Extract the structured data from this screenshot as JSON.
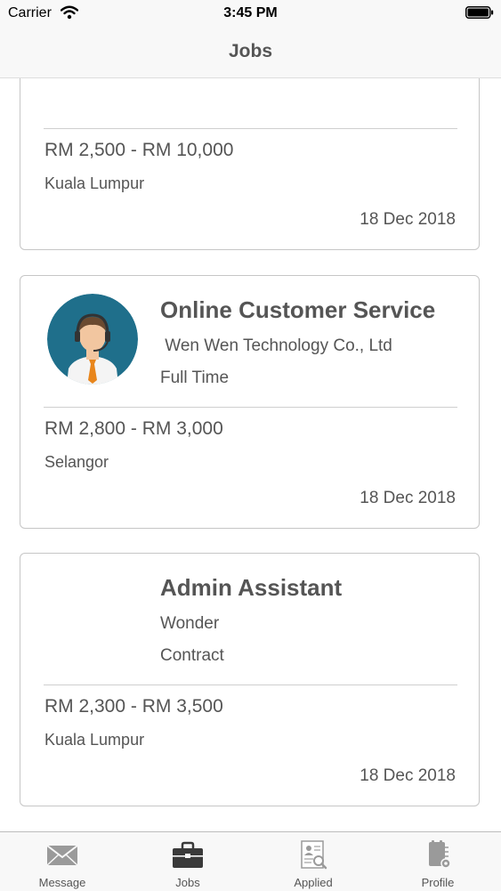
{
  "status_bar": {
    "carrier": "Carrier",
    "time": "3:45 PM"
  },
  "nav": {
    "title": "Jobs"
  },
  "jobs": [
    {
      "title": "",
      "company": "",
      "type": "",
      "salary": "RM 2,500 - RM 10,000",
      "location": "Kuala Lumpur",
      "date": "18 Dec 2018"
    },
    {
      "title": "Online Customer Service",
      "company": " Wen Wen Technology Co., Ltd",
      "type": "Full Time",
      "salary": "RM 2,800 - RM 3,000",
      "location": "Selangor",
      "date": "18 Dec 2018",
      "avatar": "customer-service-avatar"
    },
    {
      "title": "Admin Assistant",
      "company": "Wonder",
      "type": "Contract",
      "salary": "RM 2,300 - RM 3,500",
      "location": "Kuala Lumpur",
      "date": "18 Dec 2018"
    }
  ],
  "tabs": [
    {
      "label": "Message",
      "icon": "envelope-icon"
    },
    {
      "label": "Jobs",
      "icon": "briefcase-icon",
      "active": true
    },
    {
      "label": "Applied",
      "icon": "resume-icon"
    },
    {
      "label": "Profile",
      "icon": "profile-settings-icon"
    }
  ],
  "colors": {
    "text": "#555555",
    "bar_bg": "#f8f8f8",
    "avatar_bg": "#1f6f8b",
    "tie": "#e8861c"
  }
}
